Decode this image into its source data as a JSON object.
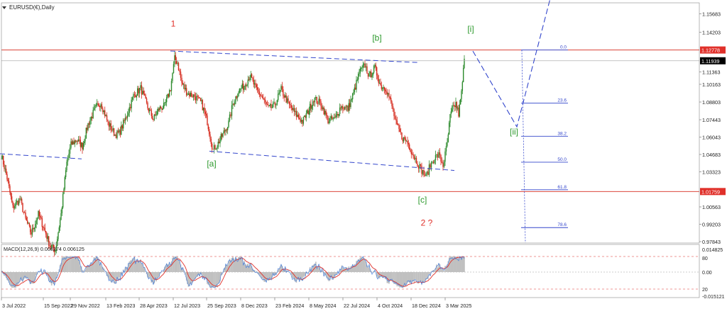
{
  "header": {
    "symbol_label": "EURUSD(€),Daily",
    "icon": "chevron-down-icon"
  },
  "colors": {
    "background": "#ffffff",
    "candle_up": "#2e8b2e",
    "candle_down": "#d62c1f",
    "horizontal_lines": "#d62c1f",
    "trendlines": "#3346cc",
    "fibonacci": "#3346cc",
    "wave_green": "#2e9a2e",
    "wave_red": "#e0302a",
    "price_tag": "#e0302a",
    "current_price_tag": "#000000",
    "macd_histogram": "#c0c0c0",
    "macd_signal": "#e0302a",
    "macd_extra": "#3b7ae0"
  },
  "chart_data": [
    {
      "type": "candlestick",
      "title": "EURUSD(€),Daily",
      "x_tick_labels": [
        "3 Jul 2022",
        "15 Sep 2022",
        "29 Nov 2022",
        "13 Feb 2023",
        "28 Apr 2023",
        "12 Jul 2023",
        "25 Sep 2023",
        "8 Dec 2023",
        "23 Feb 2024",
        "8 May 2024",
        "22 Jul 2024",
        "4 Oct 2024",
        "18 Dec 2024",
        "3 Mar 2025"
      ],
      "y_tick_labels": [
        "1.15683",
        "1.14203",
        "1.11363",
        "1.10163",
        "1.08803",
        "1.07443",
        "1.06043",
        "1.04683",
        "1.03323",
        "1.00563",
        "0.99203",
        "0.97843"
      ],
      "ylim": [
        0.9775,
        1.1645
      ],
      "grid": false,
      "price_path": [
        [
          0,
          1.046
        ],
        [
          8,
          1.028
        ],
        [
          16,
          1.005
        ],
        [
          26,
          1.012
        ],
        [
          34,
          0.996
        ],
        [
          42,
          0.985
        ],
        [
          52,
          1.0
        ],
        [
          60,
          0.989
        ],
        [
          68,
          0.976
        ],
        [
          76,
          0.972
        ],
        [
          84,
          1.0
        ],
        [
          92,
          1.04
        ],
        [
          98,
          1.054
        ],
        [
          106,
          1.058
        ],
        [
          114,
          1.053
        ],
        [
          122,
          1.07
        ],
        [
          132,
          1.082
        ],
        [
          140,
          1.087
        ],
        [
          150,
          1.071
        ],
        [
          160,
          1.062
        ],
        [
          166,
          1.063
        ],
        [
          176,
          1.076
        ],
        [
          186,
          1.092
        ],
        [
          196,
          1.098
        ],
        [
          206,
          1.083
        ],
        [
          214,
          1.074
        ],
        [
          222,
          1.082
        ],
        [
          230,
          1.084
        ],
        [
          238,
          1.098
        ],
        [
          244,
          1.121
        ],
        [
          248,
          1.118
        ],
        [
          254,
          1.102
        ],
        [
          262,
          1.094
        ],
        [
          272,
          1.092
        ],
        [
          282,
          1.086
        ],
        [
          290,
          1.072
        ],
        [
          298,
          1.05
        ],
        [
          304,
          1.054
        ],
        [
          312,
          1.062
        ],
        [
          320,
          1.071
        ],
        [
          326,
          1.086
        ],
        [
          334,
          1.096
        ],
        [
          342,
          1.1
        ],
        [
          350,
          1.108
        ],
        [
          358,
          1.098
        ],
        [
          366,
          1.092
        ],
        [
          376,
          1.082
        ],
        [
          384,
          1.084
        ],
        [
          394,
          1.097
        ],
        [
          404,
          1.086
        ],
        [
          414,
          1.078
        ],
        [
          424,
          1.072
        ],
        [
          432,
          1.08
        ],
        [
          440,
          1.09
        ],
        [
          450,
          1.086
        ],
        [
          460,
          1.073
        ],
        [
          470,
          1.074
        ],
        [
          478,
          1.084
        ],
        [
          488,
          1.082
        ],
        [
          496,
          1.094
        ],
        [
          504,
          1.11
        ],
        [
          512,
          1.116
        ],
        [
          518,
          1.107
        ],
        [
          526,
          1.114
        ],
        [
          534,
          1.1
        ],
        [
          542,
          1.098
        ],
        [
          550,
          1.084
        ],
        [
          556,
          1.07
        ],
        [
          564,
          1.06
        ],
        [
          572,
          1.056
        ],
        [
          580,
          1.046
        ],
        [
          586,
          1.04
        ],
        [
          592,
          1.034
        ],
        [
          598,
          1.029
        ],
        [
          604,
          1.038
        ],
        [
          610,
          1.044
        ],
        [
          616,
          1.046
        ],
        [
          622,
          1.038
        ],
        [
          628,
          1.055
        ],
        [
          632,
          1.076
        ],
        [
          636,
          1.082
        ],
        [
          640,
          1.086
        ],
        [
          644,
          1.078
        ],
        [
          648,
          1.094
        ],
        [
          652,
          1.121
        ]
      ],
      "horizontal_lines": [
        {
          "price": 1.12778,
          "label": "1.12778"
        },
        {
          "price": 1.01759,
          "label": "1.01759"
        }
      ],
      "current_price": {
        "price": 1.11939,
        "label": "1.11939"
      },
      "trendlines": [
        [
          [
            0,
            1.047
          ],
          [
            115,
            1.043
          ]
        ],
        [
          [
            240,
            1.127
          ],
          [
            590,
            1.118
          ]
        ],
        [
          [
            295,
            1.049
          ],
          [
            640,
            1.034
          ]
        ]
      ],
      "fibonacci": {
        "levels": [
          {
            "label": "0.0",
            "price": 1.12778
          },
          {
            "label": "23.6",
            "price": 1.0865
          },
          {
            "label": "38.2",
            "price": 1.0606
          },
          {
            "label": "50.0",
            "price": 1.0404
          },
          {
            "label": "61.8",
            "price": 1.019
          },
          {
            "label": "78.6",
            "price": 0.9895
          }
        ],
        "anchor_high": 1.12778,
        "anchor_low": 0.97843
      },
      "wave_projection": [
        [
          666,
          1.127
        ],
        [
          728,
          1.068
        ],
        [
          776,
          1.17
        ]
      ],
      "wave_labels": [
        {
          "text": "1",
          "color": "red",
          "x": 244,
          "price": 1.146
        },
        {
          "text": "[b]",
          "color": "green",
          "x": 531,
          "price": 1.135
        },
        {
          "text": "[i]",
          "color": "green",
          "x": 663,
          "price": 1.142
        },
        {
          "text": "[a]",
          "color": "green",
          "x": 298,
          "price": 1.037
        },
        {
          "text": "[ii]",
          "color": "green",
          "x": 724,
          "price": 1.062
        },
        {
          "text": "[c]",
          "color": "green",
          "x": 595,
          "price": 1.009
        },
        {
          "text": "2 ?",
          "color": "red",
          "x": 601,
          "price": 0.991
        }
      ]
    },
    {
      "type": "line",
      "title": "MACD(12,26,9) 0.008274 0.006125",
      "y_tick_labels": [
        "0.014825",
        "80",
        "0.00",
        "20",
        "-0.015121"
      ],
      "horizontal_levels": [
        "80",
        "20"
      ]
    }
  ]
}
